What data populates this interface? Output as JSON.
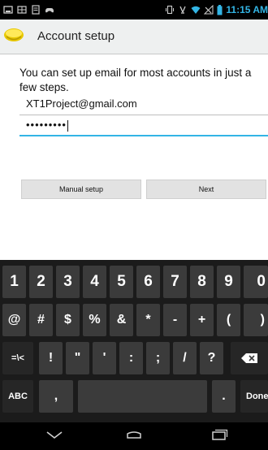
{
  "status_bar": {
    "time": "11:15 AM",
    "left_icons": [
      "screenshot-icon",
      "keyboard-status-icon",
      "document-icon",
      "gamepad-icon"
    ],
    "right_icons": [
      "vibrate-icon",
      "alarm-icon",
      "wifi-icon",
      "no-signal-icon",
      "battery-icon"
    ],
    "accent_color": "#33b5e5"
  },
  "action_bar": {
    "title": "Account setup"
  },
  "form": {
    "intro": "You can set up email for most accounts in just a few steps.",
    "email_value": "XT1Project@gmail.com",
    "password_value": "•••••••••",
    "manual_setup_label": "Manual setup",
    "next_label": "Next"
  },
  "keyboard": {
    "row1": [
      "1",
      "2",
      "3",
      "4",
      "5",
      "6",
      "7",
      "8",
      "9",
      "0"
    ],
    "row2": [
      "@",
      "#",
      "$",
      "%",
      "&",
      "*",
      "-",
      "+",
      "(",
      ")"
    ],
    "row3": [
      "=\\<",
      "!",
      "\"",
      "'",
      ":",
      ";",
      "/",
      "?"
    ],
    "abc_label": "ABC",
    "comma_label": ",",
    "period_label": ".",
    "done_label": "Done"
  },
  "nav_bar": {
    "icons": [
      "back-icon",
      "home-icon",
      "recent-apps-icon"
    ]
  }
}
